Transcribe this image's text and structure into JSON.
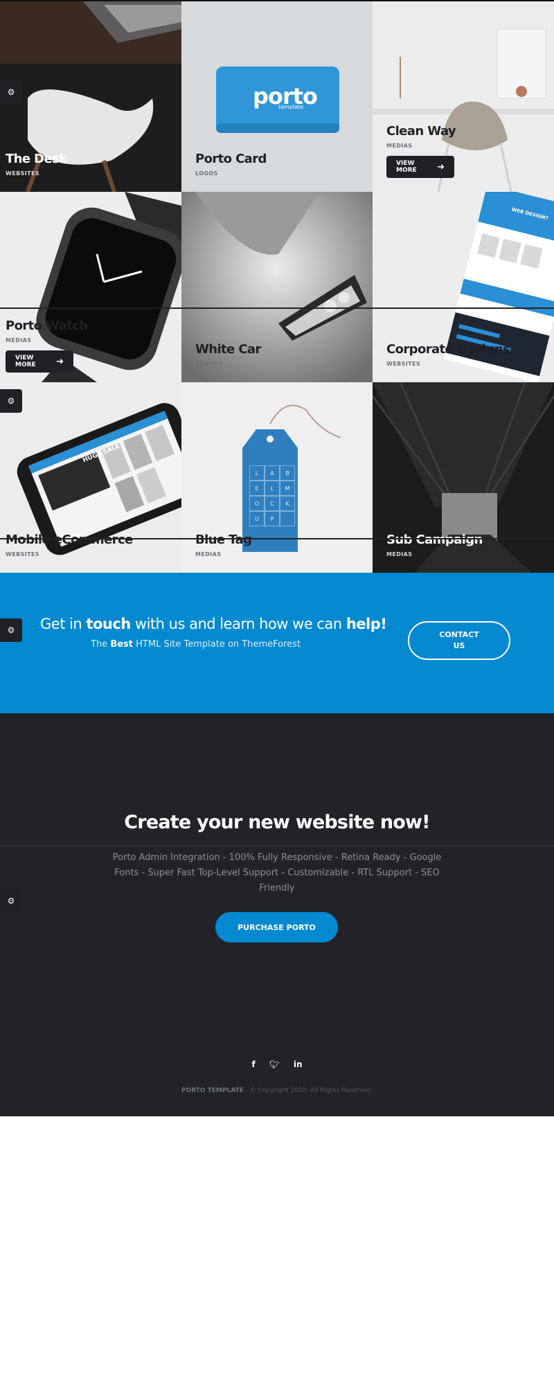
{
  "portfolio": [
    {
      "title": "The Desk",
      "category": "WEBSITES",
      "theme": "dark",
      "image": "desk-chair-photo"
    },
    {
      "title": "Porto Card",
      "category": "LOGOS",
      "theme": "light",
      "image": "porto-card-photo",
      "logo_text": "porto",
      "logo_sub": "template"
    },
    {
      "title": "Clean Way",
      "category": "MEDIAS",
      "theme": "light",
      "image": "chair-room-photo",
      "button": "VIEW MORE"
    },
    {
      "title": "Porto Watch",
      "category": "MEDIAS",
      "theme": "light",
      "image": "watch-photo",
      "button": "VIEW MORE"
    },
    {
      "title": "White Car",
      "category": "BRANDS",
      "theme": "light",
      "image": "car-headlight-photo"
    },
    {
      "title": "Corporate Designs",
      "category": "WEBSITES",
      "theme": "light",
      "image": "web-design-photo",
      "screen_text": "WEB DESIGN?"
    },
    {
      "title": "Mobile eCommerce",
      "category": "WEBSITES",
      "theme": "light",
      "image": "phone-photo",
      "screen_text": "HUGE SALE"
    },
    {
      "title": "Blue Tag",
      "category": "MEDIAS",
      "theme": "light",
      "image": "blue-tag-photo",
      "tag_letters": [
        "L",
        "A",
        "B",
        "E",
        "L",
        "M",
        "O",
        "C",
        "K",
        "U",
        "P"
      ]
    },
    {
      "title": "Sub Campaign",
      "category": "MEDIAS",
      "theme": "dark",
      "image": "subway-photo"
    }
  ],
  "cta": {
    "headline_pre": "Get in ",
    "headline_b1": "touch",
    "headline_mid": " with us and learn how we can ",
    "headline_b2": "help!",
    "sub_pre": "The ",
    "sub_b": "Best",
    "sub_post": " HTML Site Template on ThemeForest",
    "button": "CONTACT US"
  },
  "footer": {
    "title": "Create your new website now!",
    "description": "Porto Admin Integration - 100% Fully Responsive - Retina Ready - Google Fonts - Super Fast Top-Level Support - Customizable - RTL Support - SEO Friendly",
    "button": "PURCHASE PORTO",
    "social": [
      "facebook-icon",
      "twitter-icon",
      "linkedin-icon"
    ],
    "copyright_brand": "PORTO TEMPLATE",
    "copyright_rest": " - © Copyright 2020. All Rights Reserved."
  },
  "colors": {
    "primary": "#0289cf",
    "dark": "#212328",
    "tile_dark": "#1f2126"
  },
  "icons": {
    "gear": "gears-icon"
  }
}
